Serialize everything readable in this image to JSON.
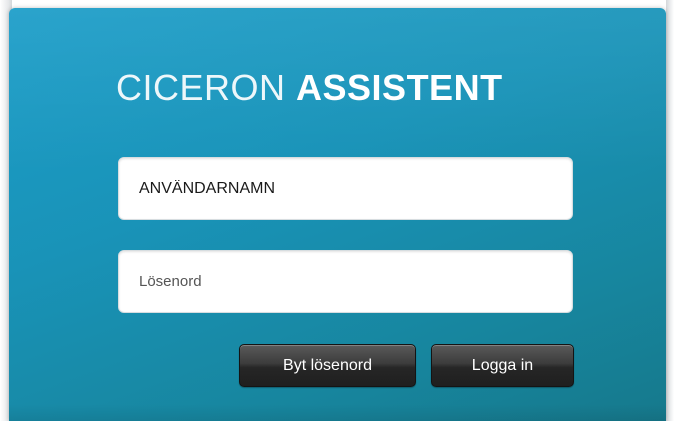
{
  "app": {
    "title_light": "CICERON",
    "title_bold": "ASSISTENT"
  },
  "login": {
    "username_value": "ANVÄNDARNAMN",
    "password_placeholder": "Lösenord",
    "change_password_label": "Byt lösenord",
    "login_label": "Logga in"
  },
  "colors": {
    "panel_top": "#1d9ec9",
    "panel_bottom": "#16798c",
    "button_dark": "#262626",
    "text_white": "#ffffff"
  }
}
